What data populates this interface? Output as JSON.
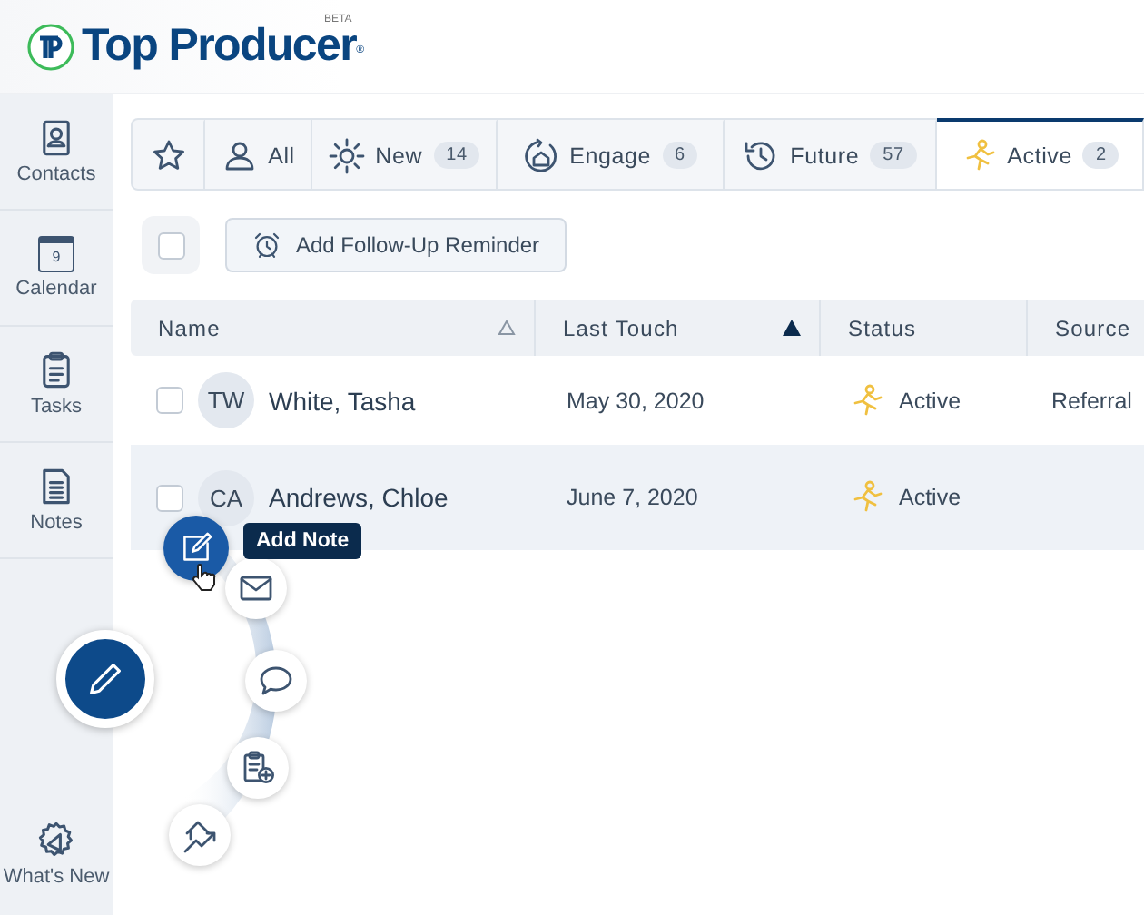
{
  "header": {
    "brand": "Top Producer",
    "registered_mark": "®",
    "badge": "BETA"
  },
  "sidebar": {
    "items": [
      {
        "label": "Contacts",
        "selected": false
      },
      {
        "label": "Calendar",
        "selected": false,
        "icon_text": "9"
      },
      {
        "label": "Tasks",
        "selected": false
      },
      {
        "label": "Notes",
        "selected": false
      }
    ],
    "footer": {
      "label": "What's New"
    }
  },
  "tabs": [
    {
      "selected": false
    },
    {
      "label": "All",
      "selected": false
    },
    {
      "label": "New",
      "count": "14",
      "selected": false
    },
    {
      "label": "Engage",
      "count": "6",
      "selected": false
    },
    {
      "label": "Future",
      "count": "57",
      "selected": false
    },
    {
      "label": "Active",
      "count": "2",
      "selected": true
    }
  ],
  "toolbar": {
    "select_all": {
      "checked": false
    },
    "button": "Add Follow-Up Reminder"
  },
  "table": {
    "columns": [
      {
        "label": "Name",
        "sortable": true,
        "sorted": false
      },
      {
        "label": "Last Touch",
        "sortable": true,
        "sorted": true
      },
      {
        "label": "Status"
      },
      {
        "label": "Source"
      }
    ],
    "rows": [
      {
        "checked": false,
        "highlighted": false,
        "initials": "TW",
        "name": "White, Tasha",
        "last_touch": "May 30, 2020",
        "status": "Active",
        "source": "Referral"
      },
      {
        "checked": false,
        "highlighted": true,
        "initials": "CA",
        "name": "Andrews, Chloe",
        "last_touch": "June 7, 2020",
        "status": "Active"
      }
    ]
  },
  "quick_actions": {
    "expanded": true,
    "tooltip": "Add Note",
    "items": [
      {
        "selected": true
      },
      {
        "selected": false
      },
      {
        "selected": false
      },
      {
        "selected": false
      },
      {
        "selected": false
      }
    ]
  }
}
